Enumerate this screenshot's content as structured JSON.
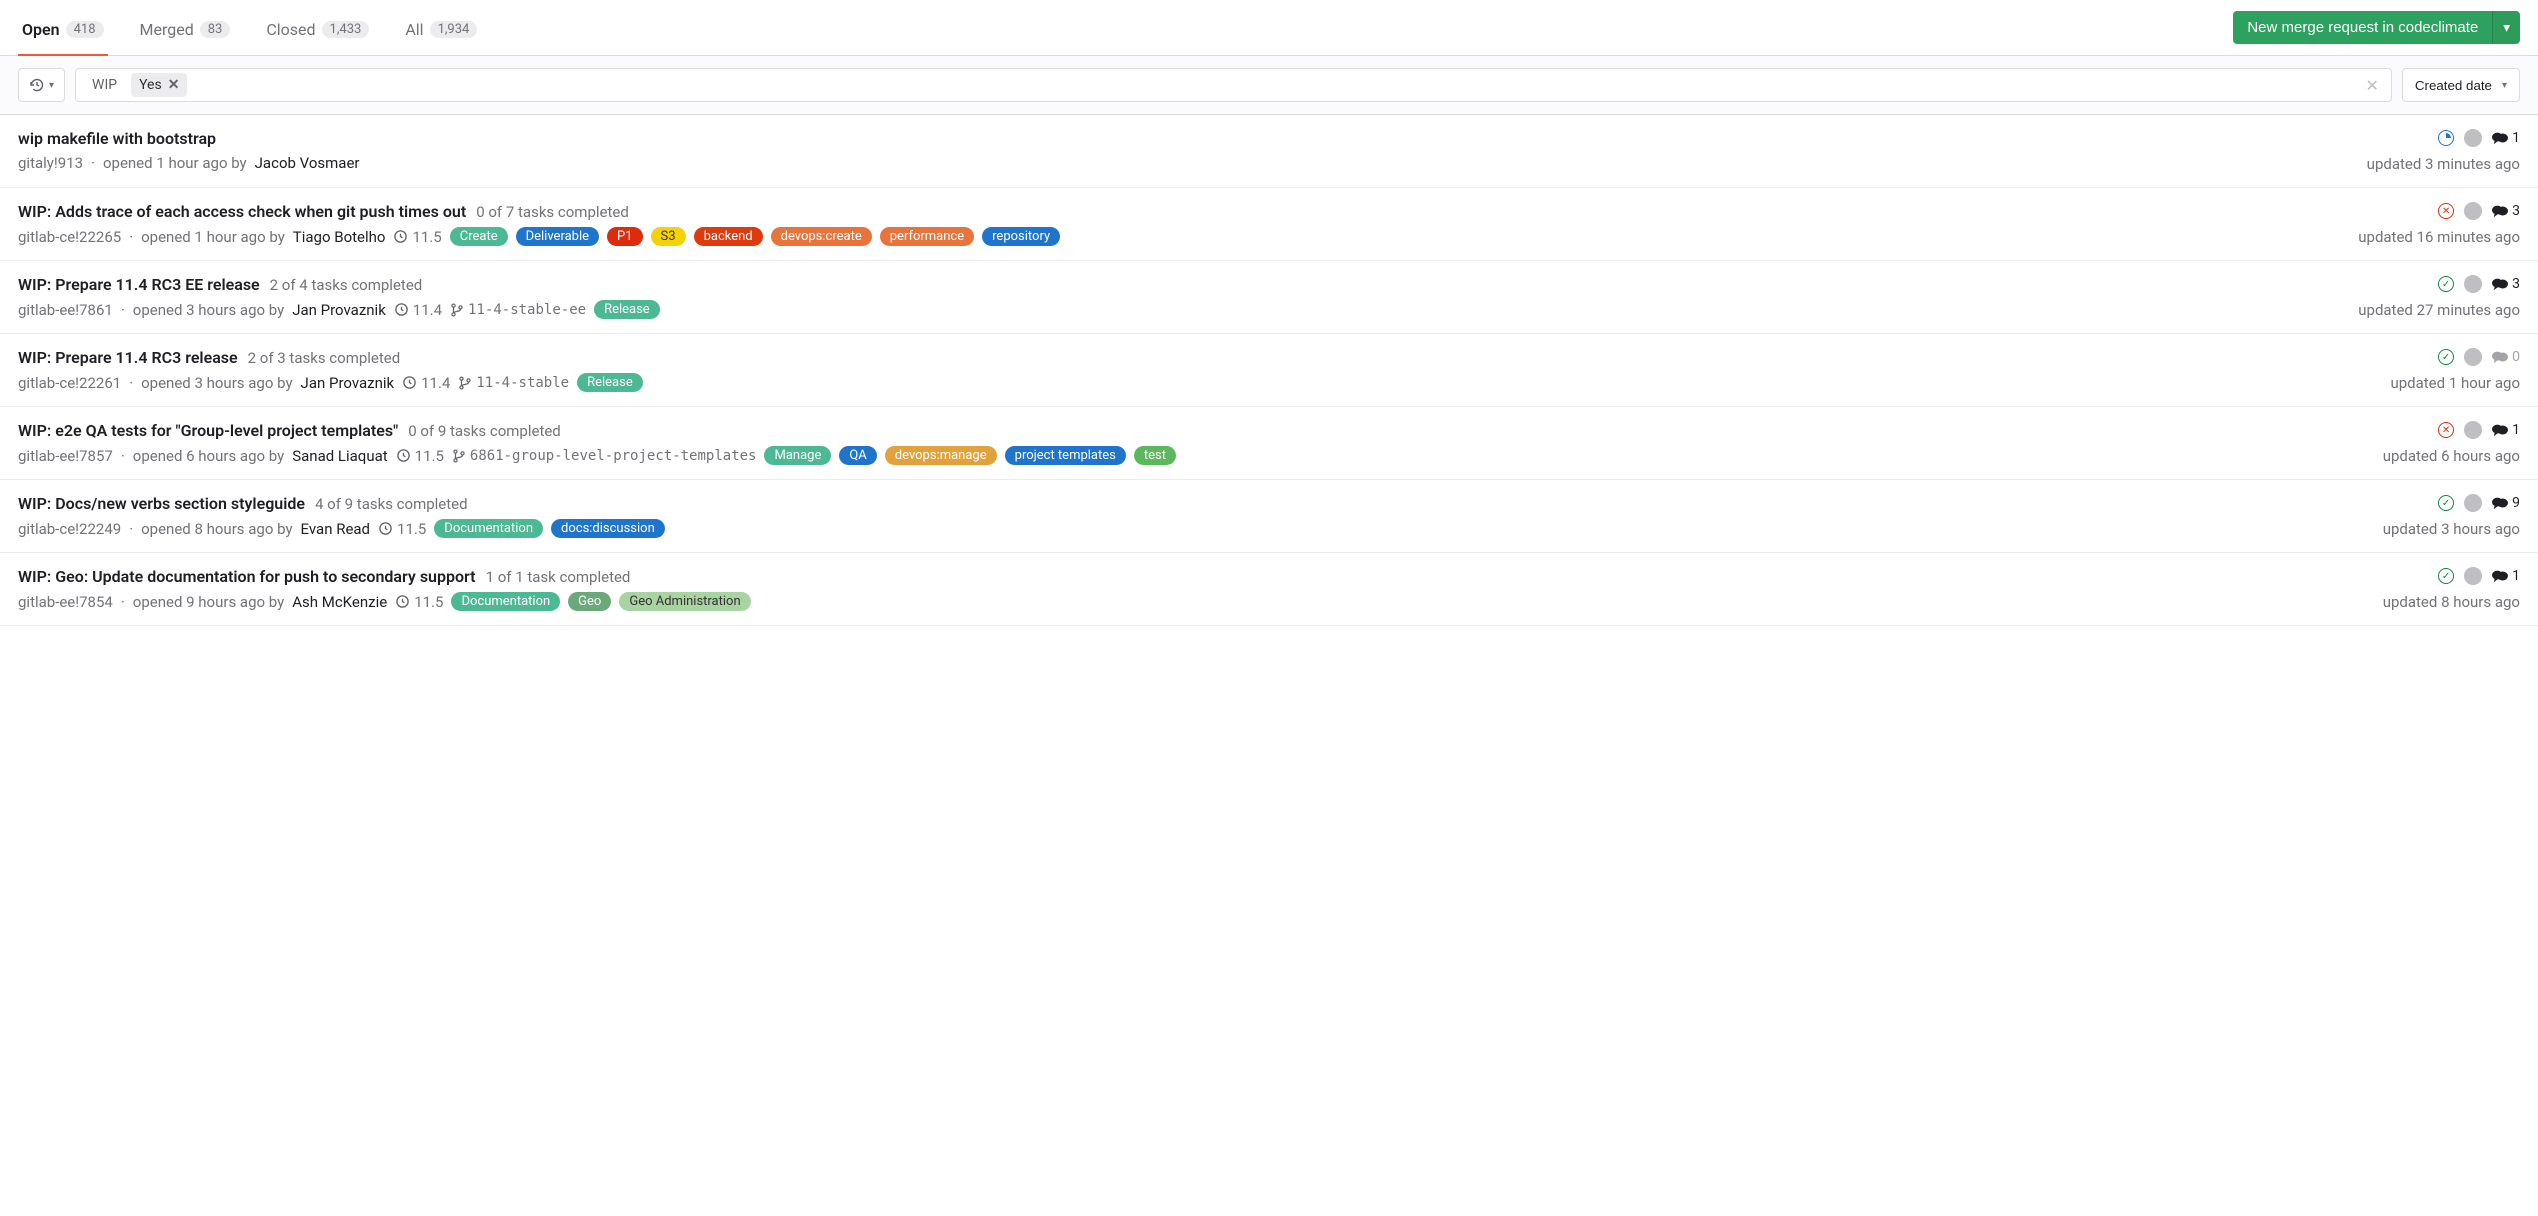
{
  "tabs": {
    "open": {
      "label": "Open",
      "count": "418"
    },
    "merged": {
      "label": "Merged",
      "count": "83"
    },
    "closed": {
      "label": "Closed",
      "count": "1,433"
    },
    "all": {
      "label": "All",
      "count": "1,934"
    }
  },
  "new_mr_button": "New merge request in codeclimate",
  "filter": {
    "token_key": "WIP",
    "token_value": "Yes"
  },
  "sort_label": "Created date",
  "rows": [
    {
      "title": "wip makefile with bootstrap",
      "tasks": "",
      "ref": "gitaly!913",
      "opened": "opened 1 hour ago by",
      "author": "Jacob Vosmaer",
      "milestone": "",
      "branch": "",
      "labels": [],
      "pipeline": "running",
      "comments": "1",
      "comments_muted": false,
      "updated": "updated 3 minutes ago"
    },
    {
      "title": "WIP: Adds trace of each access check when git push times out",
      "tasks": "0 of 7 tasks completed",
      "ref": "gitlab-ce!22265",
      "opened": "opened 1 hour ago by",
      "author": "Tiago Botelho",
      "milestone": "11.5",
      "branch": "",
      "labels": [
        {
          "text": "Create",
          "bg": "#4db894",
          "fg": "#fff"
        },
        {
          "text": "Deliverable",
          "bg": "#1f75cb",
          "fg": "#fff"
        },
        {
          "text": "P1",
          "bg": "#dd2b0e",
          "fg": "#fff"
        },
        {
          "text": "S3",
          "bg": "#f5d10a",
          "fg": "#333"
        },
        {
          "text": "backend",
          "bg": "#dd3b0e",
          "fg": "#fff"
        },
        {
          "text": "devops:create",
          "bg": "#e9743b",
          "fg": "#fff"
        },
        {
          "text": "performance",
          "bg": "#e9743b",
          "fg": "#fff"
        },
        {
          "text": "repository",
          "bg": "#1f75cb",
          "fg": "#fff"
        }
      ],
      "pipeline": "fail",
      "comments": "3",
      "comments_muted": false,
      "updated": "updated 16 minutes ago"
    },
    {
      "title": "WIP: Prepare 11.4 RC3 EE release",
      "tasks": "2 of 4 tasks completed",
      "ref": "gitlab-ee!7861",
      "opened": "opened 3 hours ago by",
      "author": "Jan Provaznik",
      "milestone": "11.4",
      "branch": "11-4-stable-ee",
      "labels": [
        {
          "text": "Release",
          "bg": "#4db894",
          "fg": "#fff"
        }
      ],
      "pipeline": "pass",
      "comments": "3",
      "comments_muted": false,
      "updated": "updated 27 minutes ago"
    },
    {
      "title": "WIP: Prepare 11.4 RC3 release",
      "tasks": "2 of 3 tasks completed",
      "ref": "gitlab-ce!22261",
      "opened": "opened 3 hours ago by",
      "author": "Jan Provaznik",
      "milestone": "11.4",
      "branch": "11-4-stable",
      "labels": [
        {
          "text": "Release",
          "bg": "#4db894",
          "fg": "#fff"
        }
      ],
      "pipeline": "pass",
      "comments": "0",
      "comments_muted": true,
      "updated": "updated 1 hour ago"
    },
    {
      "title": "WIP: e2e QA tests for \"Group-level project templates\"",
      "tasks": "0 of 9 tasks completed",
      "ref": "gitlab-ee!7857",
      "opened": "opened 6 hours ago by",
      "author": "Sanad Liaquat",
      "milestone": "11.5",
      "branch": "6861-group-level-project-templates",
      "labels": [
        {
          "text": "Manage",
          "bg": "#4db894",
          "fg": "#fff"
        },
        {
          "text": "QA",
          "bg": "#1f75cb",
          "fg": "#fff"
        },
        {
          "text": "devops:manage",
          "bg": "#e2a23b",
          "fg": "#fff"
        },
        {
          "text": "project templates",
          "bg": "#1f75cb",
          "fg": "#fff"
        },
        {
          "text": "test",
          "bg": "#5cb85c",
          "fg": "#fff"
        }
      ],
      "pipeline": "fail",
      "comments": "1",
      "comments_muted": false,
      "updated": "updated 6 hours ago"
    },
    {
      "title": "WIP: Docs/new verbs section styleguide",
      "tasks": "4 of 9 tasks completed",
      "ref": "gitlab-ce!22249",
      "opened": "opened 8 hours ago by",
      "author": "Evan Read",
      "milestone": "11.5",
      "branch": "",
      "labels": [
        {
          "text": "Documentation",
          "bg": "#4db894",
          "fg": "#fff"
        },
        {
          "text": "docs:discussion",
          "bg": "#1f75cb",
          "fg": "#fff"
        }
      ],
      "pipeline": "pass",
      "comments": "9",
      "comments_muted": false,
      "updated": "updated 3 hours ago"
    },
    {
      "title": "WIP: Geo: Update documentation for push to secondary support",
      "tasks": "1 of 1 task completed",
      "ref": "gitlab-ee!7854",
      "opened": "opened 9 hours ago by",
      "author": "Ash McKenzie",
      "milestone": "11.5",
      "branch": "",
      "labels": [
        {
          "text": "Documentation",
          "bg": "#4db894",
          "fg": "#fff"
        },
        {
          "text": "Geo",
          "bg": "#6ba87a",
          "fg": "#fff"
        },
        {
          "text": "Geo Administration",
          "bg": "#a9d3a2",
          "fg": "#333"
        }
      ],
      "pipeline": "pass",
      "comments": "1",
      "comments_muted": false,
      "updated": "updated 8 hours ago"
    }
  ]
}
